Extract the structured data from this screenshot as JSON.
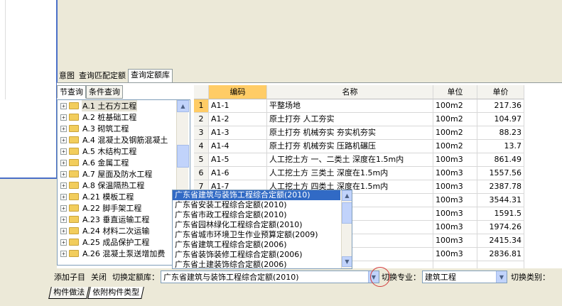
{
  "top_tabs": [
    "意图",
    "查询匹配定额",
    "查询定额库"
  ],
  "sub_tabs": [
    "节查询",
    "条件查询"
  ],
  "tree_items": [
    {
      "label": "A.1 土石方工程",
      "selected": true
    },
    {
      "label": "A.2 桩基础工程"
    },
    {
      "label": "A.3 砌筑工程"
    },
    {
      "label": "A.4 混凝土及钢筋混凝土"
    },
    {
      "label": "A.5 木结构工程"
    },
    {
      "label": "A.6 金属工程"
    },
    {
      "label": "A.7 屋面及防水工程"
    },
    {
      "label": "A.8 保温隔热工程"
    },
    {
      "label": "A.21 模板工程"
    },
    {
      "label": "A.22 脚手架工程"
    },
    {
      "label": "A.23 垂直运输工程"
    },
    {
      "label": "A.24 材料二次运输"
    },
    {
      "label": "A.25 成品保护工程"
    },
    {
      "label": "A.26 混凝土泵送增加费"
    }
  ],
  "grid": {
    "headers": [
      "",
      "编码",
      "名称",
      "单位",
      "单价"
    ],
    "rows": [
      {
        "n": "1",
        "code": "A1-1",
        "name": "平整场地",
        "unit": "100m2",
        "price": "217.36"
      },
      {
        "n": "2",
        "code": "A1-2",
        "name": "原土打夯 人工夯实",
        "unit": "100m2",
        "price": "104.97"
      },
      {
        "n": "3",
        "code": "A1-3",
        "name": "原土打夯 机械夯实 夯实机夯实",
        "unit": "100m2",
        "price": "88.23"
      },
      {
        "n": "4",
        "code": "A1-4",
        "name": "原土打夯 机械夯实 压路机碾压",
        "unit": "100m2",
        "price": "13.7"
      },
      {
        "n": "5",
        "code": "A1-5",
        "name": "人工挖土方 一、二类土 深度在1.5m内",
        "unit": "100m3",
        "price": "861.49"
      },
      {
        "n": "6",
        "code": "A1-6",
        "name": "人工挖土方 三类土 深度在1.5m内",
        "unit": "100m3",
        "price": "1557.56"
      },
      {
        "n": "7",
        "code": "A1-7",
        "name": "人工挖土方 四类土 深度在1.5m内",
        "unit": "100m3",
        "price": "2387.78"
      },
      {
        "n": "",
        "code": "",
        "name": "",
        "unit": "100m3",
        "price": "3544.31"
      },
      {
        "n": "",
        "code": "",
        "name": "二类土 深度在2m内",
        "unit": "100m3",
        "price": "1591.5"
      },
      {
        "n": "",
        "code": "",
        "name": "二类土 深度在4m内",
        "unit": "100m3",
        "price": "1974.26"
      },
      {
        "n": "",
        "code": "",
        "name": "二类土 深度在6m内",
        "unit": "100m3",
        "price": "2415.34"
      },
      {
        "n": "",
        "code": "",
        "name": "类土 深度在2m内",
        "unit": "100m3",
        "price": "2836.81"
      },
      {
        "n": "",
        "code": "",
        "name": "",
        "unit": "",
        "price": ""
      }
    ]
  },
  "dropdown_options": [
    "广东省建筑与装饰工程综合定额(2010)",
    "广东省安装工程综合定额(2010)",
    "广东省市政工程综合定额(2010)",
    "广东省园林绿化工程综合定额(2010)",
    "广东省城市环境卫生作业预算定额(2009)",
    "广东省建筑工程综合定额(2006)",
    "广东省装饰装修工程综合定额(2006)",
    "广东省土建装饰综合定额(2006)"
  ],
  "toolbar": {
    "add_child": "添加子目",
    "close": "关闭",
    "switch_lib_label": "切换定额库：",
    "switch_lib_value": "广东省建筑与装饰工程综合定额(2010)",
    "switch_major_label": "切换专业：",
    "switch_major_value": "建筑工程",
    "switch_type_label": "切换类别："
  },
  "bottom_tabs": [
    "构件做法",
    "依附构件类型"
  ],
  "colors": {
    "highlight": "#316ac5",
    "header_code": "#ffcc66",
    "circle": "#d23a3a"
  }
}
